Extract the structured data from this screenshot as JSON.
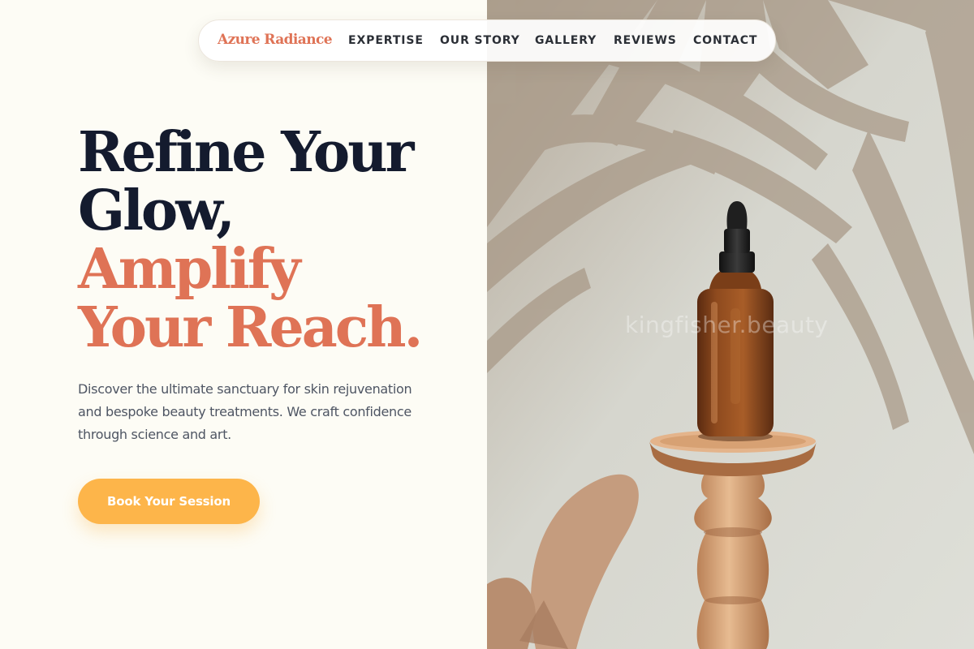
{
  "brand": {
    "name": "Azure Radiance"
  },
  "nav": {
    "links": [
      {
        "label": "EXPERTISE"
      },
      {
        "label": "OUR STORY"
      },
      {
        "label": "GALLERY"
      },
      {
        "label": "REVIEWS"
      },
      {
        "label": "CONTACT"
      }
    ]
  },
  "hero": {
    "headline": {
      "line1": "Refine Your",
      "line2": "Glow,",
      "line3": "Amplify",
      "line4": "Your Reach."
    },
    "description": "Discover the ultimate sanctuary for skin rejuvenation and bespoke beauty treatments. We craft confidence through science and art.",
    "cta_label": "Book Your Session"
  },
  "image": {
    "watermark": "kingfisher.beauty",
    "icon": "serum-dropper-bottle-on-wooden-pedestal"
  },
  "colors": {
    "background": "#fdfcf5",
    "brand_accent": "#df7356",
    "headline_dark": "#141b2e",
    "cta": "#fdb54a",
    "body_text": "#4e5563"
  }
}
